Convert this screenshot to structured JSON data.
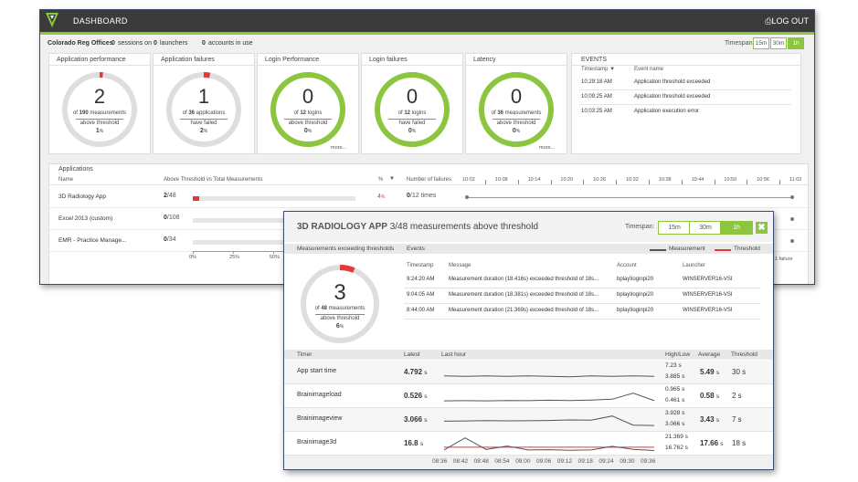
{
  "header": {
    "title": "DASHBOARD",
    "logout": "⎙LOG OUT"
  },
  "subbar": {
    "location": "Colorado Reg Offices",
    "sessions_count": "0",
    "sessions_text": "sessions on",
    "launchers_count": "0",
    "launchers_text": "launchers",
    "accounts_count": "0",
    "accounts_text": "accounts in use",
    "timespan_label": "Timespan:",
    "timespans": [
      "15m",
      "30m",
      "1h"
    ],
    "active_timespan": "1h"
  },
  "cards": [
    {
      "title": "Application performance",
      "value": "2",
      "line1_pre": "of",
      "line1_count": "190",
      "line1_post": "measurements",
      "line2": "above threshold",
      "percent": "1",
      "pct_sign": "%",
      "more": "",
      "fraction": 0.0105,
      "color": "#e53935"
    },
    {
      "title": "Application failures",
      "value": "1",
      "line1_pre": "of",
      "line1_count": "36",
      "line1_post": "applications",
      "line2": "have failed",
      "percent": "2",
      "pct_sign": "%",
      "more": "",
      "fraction": 0.0278,
      "color": "#e53935"
    },
    {
      "title": "Login Performance",
      "value": "0",
      "line1_pre": "of",
      "line1_count": "12",
      "line1_post": "logins",
      "line2": "above threshold",
      "percent": "0",
      "pct_sign": "%",
      "more": "more...",
      "fraction": 1,
      "color": "#8cc63f"
    },
    {
      "title": "Login failures",
      "value": "0",
      "line1_pre": "of",
      "line1_count": "12",
      "line1_post": "logins",
      "line2": "have failed",
      "percent": "0",
      "pct_sign": "%",
      "more": "",
      "fraction": 1,
      "color": "#8cc63f"
    },
    {
      "title": "Latency",
      "value": "0",
      "line1_pre": "of",
      "line1_count": "36",
      "line1_post": "measurements",
      "line2": "above threshold",
      "percent": "0",
      "pct_sign": "%",
      "more": "more...",
      "fraction": 1,
      "color": "#8cc63f"
    }
  ],
  "events": {
    "title": "EVENTS",
    "col_timestamp": "Timestamp ▼",
    "col_name": "Event name",
    "rows": [
      {
        "time": "10:29:18 AM",
        "name": "Application threshold exceeded"
      },
      {
        "time": "10:09:25 AM",
        "name": "Application threshold exceeded"
      },
      {
        "time": "10:03:25 AM",
        "name": "Application execution error"
      }
    ]
  },
  "applications": {
    "title": "Applications",
    "col_name": "Name",
    "col_threshold": "Above Threshold vs Total Measurements",
    "col_pct": "%",
    "col_failures": "Number of failures",
    "timeline": [
      "10:02",
      "10:08",
      "10:14",
      "10:20",
      "10:26",
      "10:32",
      "10:38",
      "10:44",
      "10:50",
      "10:56",
      "11:02"
    ],
    "rows": [
      {
        "name": "3D Radiology App",
        "above": "2",
        "total": "/48",
        "fraction": 0.0417,
        "pct": "4",
        "pct_sign": "%",
        "failures": "0",
        "failures_total": "/12 times"
      },
      {
        "name": "Excel 2013 (custom)",
        "above": "0",
        "total": "/108",
        "fraction": 0,
        "pct": "",
        "pct_sign": "",
        "failures": "",
        "failures_total": ""
      },
      {
        "name": "EMR - Practice Manage...",
        "above": "0",
        "total": "/34",
        "fraction": 0,
        "pct": "",
        "pct_sign": "",
        "failures": "",
        "failures_total": ""
      }
    ],
    "axis": [
      "0%",
      "25%",
      "50%"
    ],
    "partial_right": "1 failure"
  },
  "popup": {
    "app_name": "3D RADIOLOGY APP",
    "subtitle": "3/48 measurements above threshold",
    "timespan_label": "Timespan:",
    "timespans": [
      "15m",
      "30m",
      "1h"
    ],
    "active_timespan": "1h",
    "close": "✖",
    "gauge_section": "Measurements exceeding thresholds",
    "events_section": "Events",
    "legend_measurement": "Measurement",
    "legend_threshold": "Threshold",
    "gauge": {
      "value": "3",
      "line1_pre": "of",
      "line1_count": "48",
      "line1_post": "measurements",
      "line2": "above threshold",
      "percent": "6",
      "pct_sign": "%",
      "fraction": 0.0625
    },
    "events": {
      "cols": [
        "Timestamp",
        "Message",
        "Account",
        "Launcher"
      ],
      "rows": [
        {
          "time": "9:24:20 AM",
          "message": "Measurement duration (18.416s) exceeded threshold of 18s...",
          "account": "bplay\\loginpi20",
          "launcher": "WINSERVER16-VSI"
        },
        {
          "time": "9:04:05 AM",
          "message": "Measurement duration (18.381s) exceeded threshold of 18s...",
          "account": "bplay\\loginpi20",
          "launcher": "WINSERVER16-VSI"
        },
        {
          "time": "8:44:00 AM",
          "message": "Measurement duration (21.369s) exceeded threshold of 18s...",
          "account": "bplay\\loginpi20",
          "launcher": "WINSERVER16-VSI"
        }
      ]
    },
    "timer_cols": {
      "timer": "Timer",
      "latest": "Latest",
      "last_hour": "Last hour",
      "highlow": "High/Low",
      "average": "Average",
      "threshold": "Threshold"
    },
    "timers": [
      {
        "name": "App start time",
        "latest": "4.792",
        "unit": "s",
        "high": "7.23 s",
        "low": "3.885 s",
        "avg": "5.49",
        "threshold": "30 s",
        "series": [
          4.9,
          4.8,
          4.9,
          4.8,
          4.9,
          4.8,
          4.7,
          4.9,
          4.8,
          4.9,
          4.8
        ],
        "thr": 30,
        "min": 3.5,
        "max": 8
      },
      {
        "name": "Brainimageload",
        "latest": "0.526",
        "unit": "s",
        "high": "0.965 s",
        "low": "0.461 s",
        "avg": "0.58",
        "threshold": "2 s",
        "series": [
          0.52,
          0.53,
          0.52,
          0.54,
          0.53,
          0.55,
          0.54,
          0.56,
          0.6,
          0.9,
          0.53
        ],
        "thr": 2,
        "min": 0.3,
        "max": 1.2
      },
      {
        "name": "Brainimageview",
        "latest": "3.066",
        "unit": "s",
        "high": "3.928 s",
        "low": "3.066 s",
        "avg": "3.43",
        "threshold": "7 s",
        "series": [
          3.4,
          3.42,
          3.45,
          3.43,
          3.44,
          3.46,
          3.5,
          3.48,
          3.8,
          3.1,
          3.07
        ],
        "thr": 7,
        "min": 2.8,
        "max": 4.2
      },
      {
        "name": "Brainimage3d",
        "latest": "16.8",
        "unit": "s",
        "high": "21.369 s",
        "low": "16.762 s",
        "avg": "17.66",
        "threshold": "18 s",
        "series": [
          17,
          21.3,
          17.2,
          18.4,
          17,
          17.1,
          16.9,
          17,
          18.3,
          17.2,
          16.8
        ],
        "thr": 18,
        "min": 16,
        "max": 22.5
      }
    ],
    "time_axis": [
      "08:36",
      "08:42",
      "08:48",
      "08:54",
      "09:00",
      "09:06",
      "09:12",
      "09:18",
      "09:24",
      "09:30",
      "09:36"
    ]
  }
}
